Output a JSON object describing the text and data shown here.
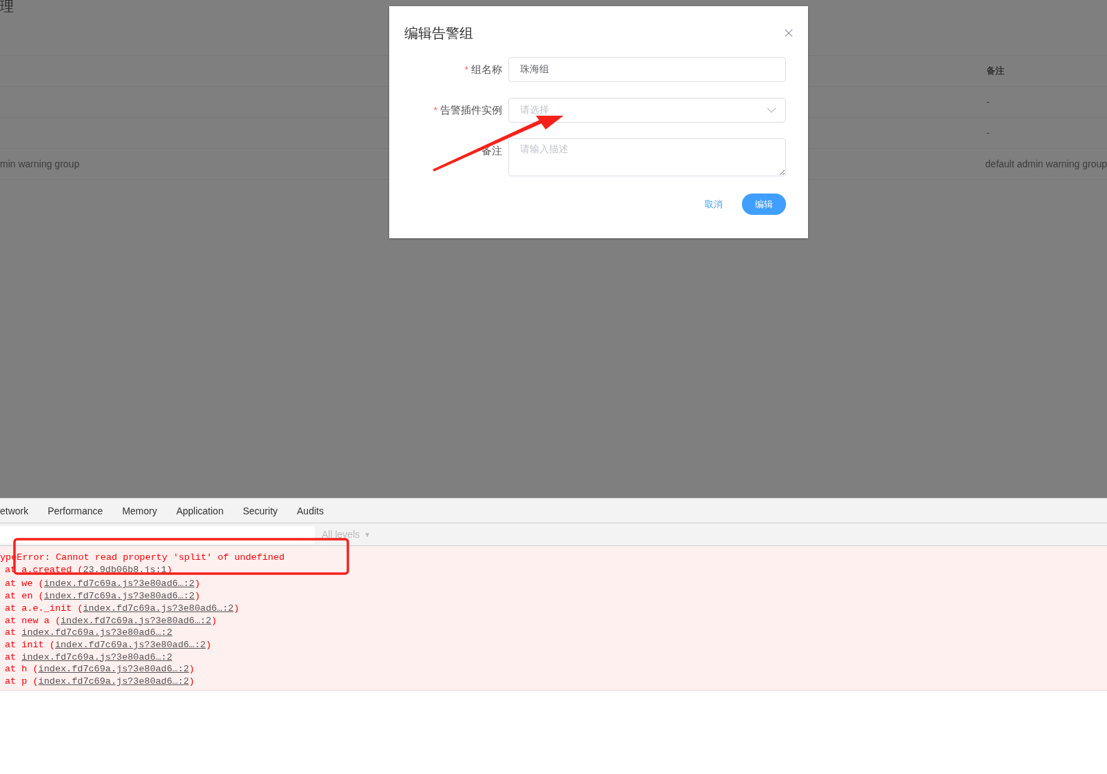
{
  "page": {
    "title": "理",
    "table": {
      "header": "备注",
      "rows": [
        {
          "remark": "-"
        },
        {
          "remark": "-"
        },
        {
          "column_1": "min warning group",
          "remark": "default admin warning group"
        }
      ]
    }
  },
  "dialog": {
    "title": "编辑告警组",
    "required_mark": "*",
    "fields": [
      {
        "kind": "input",
        "label": "组名称",
        "required": true,
        "value": "珠海组"
      },
      {
        "kind": "select",
        "label": "告警插件实例",
        "required": true,
        "placeholder": "请选择"
      },
      {
        "kind": "textarea",
        "label": "备注",
        "required": false,
        "placeholder": "请输入描述"
      }
    ],
    "buttons": [
      {
        "kind": "text",
        "label": "取消"
      },
      {
        "kind": "primary",
        "label": "编辑"
      }
    ]
  },
  "devtools": {
    "tabs": [
      {
        "label": "etwork",
        "selected": false
      },
      {
        "label": "Performance",
        "selected": false
      },
      {
        "label": "Memory",
        "selected": false
      },
      {
        "label": "Application",
        "selected": false
      },
      {
        "label": "Security",
        "selected": false
      },
      {
        "label": "Audits",
        "selected": false
      }
    ],
    "levels": "All levels",
    "levels_caret": "▼",
    "error": {
      "message": "ypeError: Cannot read property 'split' of undefined",
      "stack": [
        {
          "prefix": "at a.created (",
          "link": "23.9db06b8.js:1",
          "suffix": ")"
        },
        {
          "prefix": "at we (",
          "link": "index.fd7c69a.js?3e80ad6…:2",
          "suffix": ")"
        },
        {
          "prefix": "at en (",
          "link": "index.fd7c69a.js?3e80ad6…:2",
          "suffix": ")"
        },
        {
          "prefix": "at a.e._init (",
          "link": "index.fd7c69a.js?3e80ad6…:2",
          "suffix": ")"
        },
        {
          "prefix": "at new a (",
          "link": "index.fd7c69a.js?3e80ad6…:2",
          "suffix": ")"
        },
        {
          "prefix": "at ",
          "link": "index.fd7c69a.js?3e80ad6…:2"
        },
        {
          "prefix": "at init (",
          "link": "index.fd7c69a.js?3e80ad6…:2",
          "suffix": ")"
        },
        {
          "prefix": "at ",
          "link": "index.fd7c69a.js?3e80ad6…:2"
        },
        {
          "prefix": "at h (",
          "link": "index.fd7c69a.js?3e80ad6…:2",
          "suffix": ")"
        },
        {
          "prefix": "at p (",
          "link": "index.fd7c69a.js?3e80ad6…:2",
          "suffix": ")"
        }
      ]
    }
  },
  "annotations": {
    "arrow": true,
    "highlight_box": true
  }
}
